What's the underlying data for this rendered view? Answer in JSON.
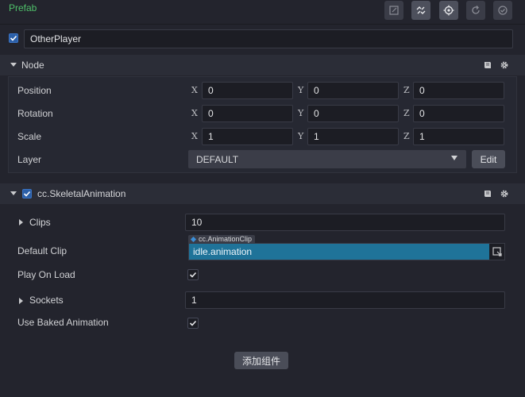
{
  "header": {
    "title": "Prefab",
    "tools": [
      "edit-icon",
      "unlink-icon",
      "locate-icon",
      "revert-icon",
      "apply-icon"
    ]
  },
  "node_name": "OtherPlayer",
  "node_section": {
    "title": "Node",
    "position": {
      "label": "Position",
      "x_label": "X",
      "y_label": "Y",
      "z_label": "Z",
      "x": "0",
      "y": "0",
      "z": "0"
    },
    "rotation": {
      "label": "Rotation",
      "x_label": "X",
      "y_label": "Y",
      "z_label": "Z",
      "x": "0",
      "y": "0",
      "z": "0"
    },
    "scale": {
      "label": "Scale",
      "x_label": "X",
      "y_label": "Y",
      "z_label": "Z",
      "x": "1",
      "y": "1",
      "z": "1"
    },
    "layer": {
      "label": "Layer",
      "value": "DEFAULT",
      "edit_label": "Edit"
    }
  },
  "component": {
    "title": "cc.SkeletalAnimation",
    "clips": {
      "label": "Clips",
      "value": "10"
    },
    "default_clip": {
      "label": "Default Clip",
      "type_tag": "cc.AnimationClip",
      "value": "idle.animation"
    },
    "play_on_load": {
      "label": "Play On Load",
      "checked": true
    },
    "sockets": {
      "label": "Sockets",
      "value": "1"
    },
    "use_baked_animation": {
      "label": "Use Baked Animation",
      "checked": true
    }
  },
  "add_component_label": "添加组件",
  "colors": {
    "accent_green": "#4fc06a",
    "checkbox_blue": "#2b5fa8",
    "asset_field": "#1f7399"
  }
}
